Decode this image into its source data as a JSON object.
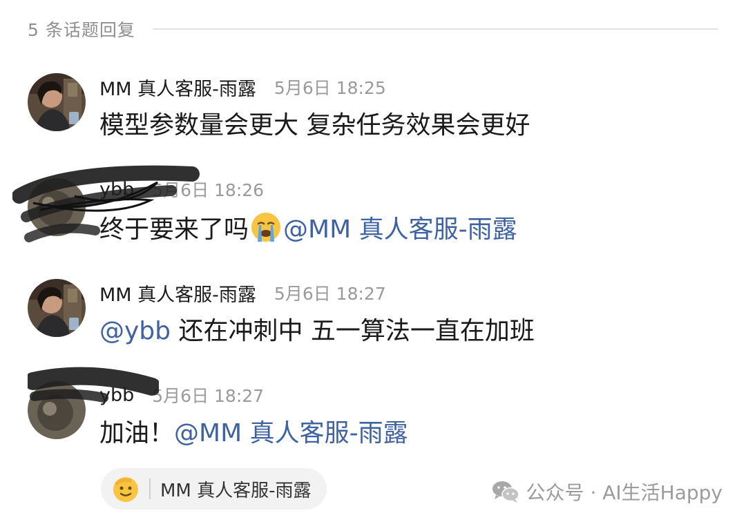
{
  "header": {
    "reply_count_label": "5 条话题回复"
  },
  "messages": [
    {
      "author": "MM 真人客服-雨露",
      "time": "5月6日 18:25",
      "text": "模型参数量会更大 复杂任务效果会更好"
    },
    {
      "author": "ybb",
      "time": "5月6日 18:26",
      "text": "终于要来了吗",
      "emoji": "crying-face",
      "mention": "@MM 真人客服-雨露"
    },
    {
      "author": "MM 真人客服-雨露",
      "time": "5月6日 18:27",
      "mention": "@ybb",
      "text": " 还在冲刺中 五一算法一直在加班"
    },
    {
      "author": "ybb",
      "time": "5月6日 18:27",
      "text": "加油！",
      "mention": "@MM 真人客服-雨露"
    }
  ],
  "reaction": {
    "emoji": "saluting-face",
    "user": "MM 真人客服-雨露"
  },
  "watermark": {
    "icon": "wechat-icon",
    "text": "公众号 · AI生活Happy"
  },
  "colors": {
    "mention": "#3f62a3",
    "timestamp": "#9a9a9a",
    "divider": "#e3e3e3",
    "reaction_bg": "#f2f2f2"
  }
}
